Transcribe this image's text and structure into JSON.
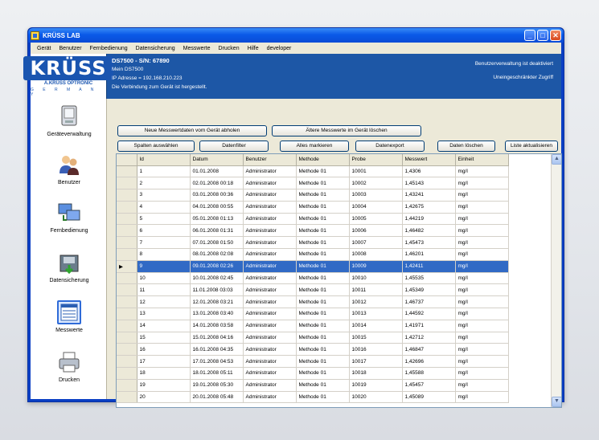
{
  "window": {
    "title": "KRÜSS LAB"
  },
  "window_controls": {
    "minimize": "_",
    "maximize": "□",
    "close": "✕"
  },
  "menu": [
    "Gerät",
    "Benutzer",
    "Fernbedienung",
    "Datensicherung",
    "Messwerte",
    "Drucken",
    "Hilfe",
    "developer"
  ],
  "logo": {
    "brand": "KRÜSS",
    "sub": "A.KRÜSS OPTRONIC",
    "country": "G E R M A N Y"
  },
  "header": {
    "device": "DS7500 - S/N: 67890",
    "name": "Mein DS7500",
    "ip": "IP Adresse = 192.168.210.223",
    "status": "Die Verbindung zum Gerät ist hergestellt.",
    "right1": "Benutzerverwaltung ist deaktiviert",
    "right2": "Uneingeschränkter Zugriff"
  },
  "sidebar": [
    {
      "label": "Geräteverwaltung",
      "icon": "device-icon"
    },
    {
      "label": "Benutzer",
      "icon": "users-icon"
    },
    {
      "label": "Fernbedienung",
      "icon": "remote-icon"
    },
    {
      "label": "Datensicherung",
      "icon": "backup-icon"
    },
    {
      "label": "Messwerte",
      "icon": "measurements-icon"
    },
    {
      "label": "Drucken",
      "icon": "printer-icon"
    }
  ],
  "buttons": {
    "fetch": "Neue Messwertdaten vom Gerät abholen",
    "delete_old": "Ältere Messwerte im Gerät löschen",
    "columns": "Spalten auswählen",
    "filter": "Datenfilter",
    "mark_all": "Alles markieren",
    "export": "Datenexport",
    "delete": "Daten löschen",
    "refresh": "Liste aktualisieren"
  },
  "table": {
    "columns": [
      "Id",
      "Datum",
      "Benutzer",
      "Methode",
      "Probe",
      "Messwert",
      "Einheit"
    ],
    "selected_row": 9,
    "rows": [
      [
        "1",
        "01.01.2008",
        "Administrator",
        "Methode 01",
        "10001",
        "1,4306",
        "mg/l"
      ],
      [
        "2",
        "02.01.2008 00:18",
        "Administrator",
        "Methode 01",
        "10002",
        "1,45143",
        "mg/l"
      ],
      [
        "3",
        "03.01.2008 00:36",
        "Administrator",
        "Methode 01",
        "10003",
        "1,43241",
        "mg/l"
      ],
      [
        "4",
        "04.01.2008 00:55",
        "Administrator",
        "Methode 01",
        "10004",
        "1,42675",
        "mg/l"
      ],
      [
        "5",
        "05.01.2008 01:13",
        "Administrator",
        "Methode 01",
        "10005",
        "1,44219",
        "mg/l"
      ],
      [
        "6",
        "06.01.2008 01:31",
        "Administrator",
        "Methode 01",
        "10006",
        "1,46482",
        "mg/l"
      ],
      [
        "7",
        "07.01.2008 01:50",
        "Administrator",
        "Methode 01",
        "10007",
        "1,45473",
        "mg/l"
      ],
      [
        "8",
        "08.01.2008 02:08",
        "Administrator",
        "Methode 01",
        "10008",
        "1,46201",
        "mg/l"
      ],
      [
        "9",
        "09.01.2008 02:26",
        "Administrator",
        "Methode 01",
        "10009",
        "1,42411",
        "mg/l"
      ],
      [
        "10",
        "10.01.2008 02:45",
        "Administrator",
        "Methode 01",
        "10010",
        "1,45535",
        "mg/l"
      ],
      [
        "11",
        "11.01.2008 03:03",
        "Administrator",
        "Methode 01",
        "10011",
        "1,45349",
        "mg/l"
      ],
      [
        "12",
        "12.01.2008 03:21",
        "Administrator",
        "Methode 01",
        "10012",
        "1,46737",
        "mg/l"
      ],
      [
        "13",
        "13.01.2008 03:40",
        "Administrator",
        "Methode 01",
        "10013",
        "1,44592",
        "mg/l"
      ],
      [
        "14",
        "14.01.2008 03:58",
        "Administrator",
        "Methode 01",
        "10014",
        "1,41971",
        "mg/l"
      ],
      [
        "15",
        "15.01.2008 04:16",
        "Administrator",
        "Methode 01",
        "10015",
        "1,42712",
        "mg/l"
      ],
      [
        "16",
        "16.01.2008 04:35",
        "Administrator",
        "Methode 01",
        "10016",
        "1,46847",
        "mg/l"
      ],
      [
        "17",
        "17.01.2008 04:53",
        "Administrator",
        "Methode 01",
        "10017",
        "1,42696",
        "mg/l"
      ],
      [
        "18",
        "18.01.2008 05:11",
        "Administrator",
        "Methode 01",
        "10018",
        "1,45588",
        "mg/l"
      ],
      [
        "19",
        "19.01.2008 05:30",
        "Administrator",
        "Methode 01",
        "10019",
        "1,45457",
        "mg/l"
      ],
      [
        "20",
        "20.01.2008 05:48",
        "Administrator",
        "Methode 01",
        "10020",
        "1,45089",
        "mg/l"
      ]
    ]
  },
  "scrollbar": {
    "up": "▲",
    "down": "▼"
  },
  "row_marker": "▶"
}
